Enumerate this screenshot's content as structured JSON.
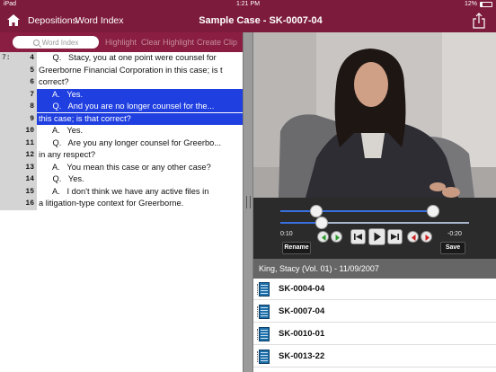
{
  "status_bar": {
    "device": "iPad",
    "time": "1:21 PM",
    "battery": "12%"
  },
  "nav": {
    "depositions_label": "Depositions",
    "word_index_label": "Word Index",
    "title": "Sample Case - SK-0007-04"
  },
  "toolbar": {
    "search_placeholder": "Word Index",
    "highlight": "Highlight",
    "clear_highlight": "Clear Highlight",
    "create_clip": "Create Clip"
  },
  "transcript": {
    "lines": [
      {
        "page": "7:",
        "line": "4",
        "text": "      Q.   Stacy, you at one point were counsel for",
        "highlighted": false
      },
      {
        "page": "",
        "line": "5",
        "text": "Greerborne Financial Corporation in this case; is t",
        "highlighted": false
      },
      {
        "page": "",
        "line": "6",
        "text": "correct?",
        "highlighted": false
      },
      {
        "page": "",
        "line": "7",
        "text": "      A.   Yes.",
        "highlighted": true
      },
      {
        "page": "",
        "line": "8",
        "text": "      Q.   And you are no longer counsel for the...",
        "highlighted": true
      },
      {
        "page": "",
        "line": "9",
        "text": "this case; is that correct?",
        "highlighted": true
      },
      {
        "page": "",
        "line": "10",
        "text": "      A.   Yes.",
        "highlighted": false
      },
      {
        "page": "",
        "line": "11",
        "text": "      Q.   Are you any longer counsel for Greerbo...",
        "highlighted": false
      },
      {
        "page": "",
        "line": "12",
        "text": "in any respect?",
        "highlighted": false
      },
      {
        "page": "",
        "line": "13",
        "text": "      A.   You mean this case or any other case?",
        "highlighted": false
      },
      {
        "page": "",
        "line": "14",
        "text": "      Q.   Yes.",
        "highlighted": false
      },
      {
        "page": "",
        "line": "15",
        "text": "      A.   I don't think we have any active files in",
        "highlighted": false
      },
      {
        "page": "",
        "line": "16",
        "text": "a litigation-type context for Greerborne.",
        "highlighted": false
      }
    ]
  },
  "player": {
    "elapsed": "0:10",
    "remaining": "-0:20",
    "rename_label": "Rename",
    "save_label": "Save",
    "progress_fraction": 0.22
  },
  "exhibits": {
    "header": "King, Stacy (Vol. 01) - 11/09/2007",
    "items": [
      {
        "label": "SK-0004-04",
        "icon": "document-icon"
      },
      {
        "label": "SK-0007-04",
        "icon": "document-icon"
      },
      {
        "label": "SK-0010-01",
        "icon": "document-icon"
      },
      {
        "label": "SK-0013-22",
        "icon": "document-icon"
      }
    ]
  },
  "colors": {
    "nav_bg": "#7d1b3c",
    "highlight": "#1f3fe0",
    "slider": "#3a6fe0"
  }
}
